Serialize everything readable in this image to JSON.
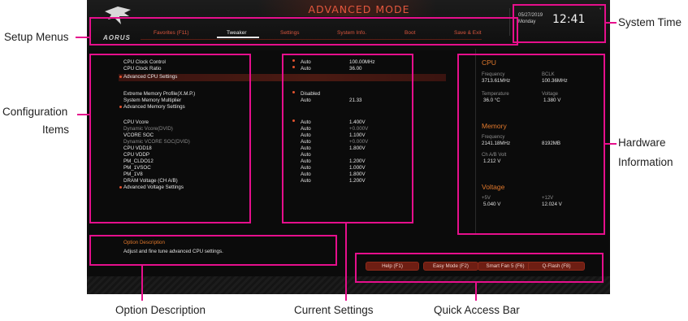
{
  "bios": {
    "mode_title": "ADVANCED MODE",
    "brand": "AORUS",
    "menus": [
      {
        "label": "Favorites (F11)"
      },
      {
        "label": "Tweaker"
      },
      {
        "label": "Settings"
      },
      {
        "label": "System Info."
      },
      {
        "label": "Boot"
      },
      {
        "label": "Save & Exit"
      }
    ],
    "active_menu": "Tweaker",
    "clock": {
      "date": "05/27/2019",
      "day": "Monday",
      "time": "12:41"
    },
    "config_items": [
      {
        "name": "CPU Clock Control",
        "mark": "",
        "setting": "Auto",
        "value": "100.00MHz",
        "dim": false
      },
      {
        "name": "CPU Clock Ratio",
        "mark": "",
        "setting": "Auto",
        "value": "36.00",
        "dim": false
      },
      {
        "name": "Advanced CPU Settings",
        "mark": "submenu",
        "setting": "",
        "value": "",
        "dim": false
      },
      {
        "name": "Extreme Memory Profile(X.M.P.)",
        "mark": "",
        "setting": "Disabled",
        "value": "",
        "dim": false
      },
      {
        "name": "System Memory Multiplier",
        "mark": "",
        "setting": "Auto",
        "value": "21.33",
        "dim": false
      },
      {
        "name": "Advanced Memory Settings",
        "mark": "submenu",
        "setting": "",
        "value": "",
        "dim": false
      },
      {
        "name": "CPU Vcore",
        "mark": "",
        "setting": "Auto",
        "value": "1.400V",
        "dim": false
      },
      {
        "name": "Dynamic Vcore(DVID)",
        "mark": "",
        "setting": "Auto",
        "value": "+0.000V",
        "dim": true
      },
      {
        "name": "VCORE SOC",
        "mark": "",
        "setting": "Auto",
        "value": "1.100V",
        "dim": false
      },
      {
        "name": "Dynamic VCORE SOC(DVID)",
        "mark": "",
        "setting": "Auto",
        "value": "+0.000V",
        "dim": true
      },
      {
        "name": "CPU VDD18",
        "mark": "",
        "setting": "Auto",
        "value": "1.800V",
        "dim": false
      },
      {
        "name": "CPU VDDP",
        "mark": "",
        "setting": "Auto",
        "value": "",
        "dim": false
      },
      {
        "name": "PM_CLDO12",
        "mark": "",
        "setting": "Auto",
        "value": "1.200V",
        "dim": false
      },
      {
        "name": "PM_1VSOC",
        "mark": "",
        "setting": "Auto",
        "value": "1.000V",
        "dim": false
      },
      {
        "name": "PM_1V8",
        "mark": "",
        "setting": "Auto",
        "value": "1.800V",
        "dim": false
      },
      {
        "name": "DRAM Voltage    (CH A/B)",
        "mark": "",
        "setting": "Auto",
        "value": "1.200V",
        "dim": false
      },
      {
        "name": "Advanced Voltage Settings",
        "mark": "submenu",
        "setting": "",
        "value": "",
        "dim": false
      }
    ],
    "hardware": {
      "cpu": {
        "heading": "CPU",
        "freq_label": "Frequency",
        "freq_value": "3713.61MHz",
        "bclk_label": "BCLK",
        "bclk_value": "100.36MHz",
        "temp_label": "Temperature",
        "temp_value": "36.0 °C",
        "volt_label": "Voltage",
        "volt_value": "1.380 V"
      },
      "memory": {
        "heading": "Memory",
        "freq_label": "Frequency",
        "freq_value": "2141.18MHz",
        "size_value": "8192MB",
        "volt_label": "Ch A/B Volt",
        "volt_value": "1.212 V"
      },
      "voltage": {
        "heading": "Voltage",
        "p5_label": "+5V",
        "p5_value": "5.040 V",
        "p12_label": "+12V",
        "p12_value": "12.024 V"
      }
    },
    "option_description": {
      "title": "Option Description",
      "text": "Adjust and fine tune advanced CPU settings."
    },
    "quick_access": [
      {
        "label": "Help (F1)"
      },
      {
        "label": "Easy Mode (F2)"
      },
      {
        "label": "Smart Fan 5 (F6)"
      },
      {
        "label": "Q-Flash (F8)"
      }
    ],
    "colors": {
      "accent": "#e3532f",
      "highlight": "#e60f8c",
      "heading": "#e0782c"
    }
  },
  "callouts": {
    "setup_menus": "Setup Menus",
    "system_time": "System Time",
    "configuration_items_line1": "Configuration",
    "configuration_items_line2": "Items",
    "hardware_information_line1": "Hardware",
    "hardware_information_line2": "Information",
    "option_description": "Option Description",
    "current_settings": "Current Settings",
    "quick_access_bar": "Quick Access Bar"
  }
}
